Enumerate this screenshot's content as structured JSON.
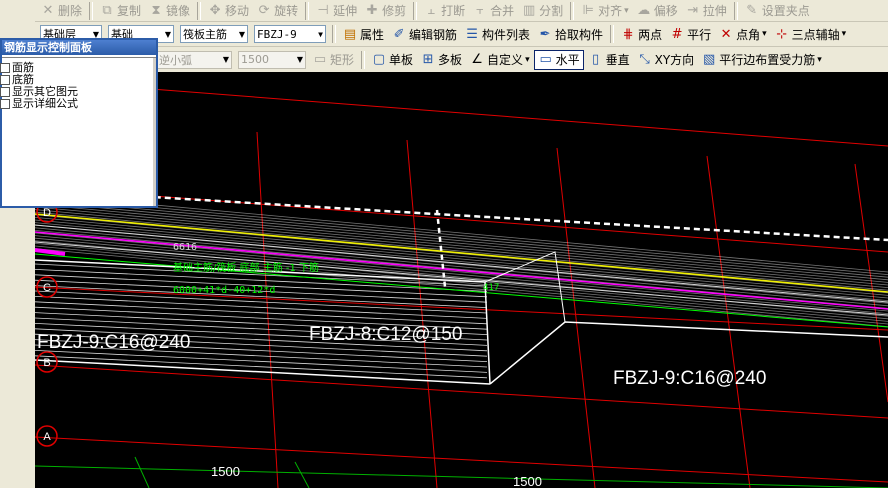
{
  "toolbar1": {
    "delete": "删除",
    "copy": "复制",
    "mirror": "镜像",
    "move": "移动",
    "rotate": "旋转",
    "extend": "延伸",
    "trim": "修剪",
    "break": "打断",
    "merge": "合并",
    "split": "分割",
    "align": "对齐",
    "offset": "偏移",
    "stretch": "拉伸",
    "set_grip": "设置夹点"
  },
  "toolbar2": {
    "floor_value": "基础层",
    "category_value": "基础",
    "type_value": "筏板主筋",
    "component_value": "FBZJ-9",
    "properties": "属性",
    "edit_rebar": "编辑钢筋",
    "component_list": "构件列表",
    "pick_component": "拾取构件",
    "two_points": "两点",
    "parallel": "平行",
    "point_angle": "点角",
    "three_point_aux": "三点辅轴"
  },
  "toolbar3": {
    "arc_value": "逆小弧",
    "radius_value": "1500",
    "rectangle": "矩形",
    "single_slab": "单板",
    "multi_slab": "多板",
    "custom": "自定义",
    "horizontal": "水平",
    "vertical": "垂直",
    "xy_direction": "XY方向",
    "parallel_edge": "平行边布置受力筋"
  },
  "panel": {
    "title": "钢筋显示控制面板",
    "items": [
      "面筋",
      "底筋",
      "显示其它图元",
      "显示详细公式"
    ]
  },
  "drawing": {
    "axis_labels": [
      "D",
      "C",
      "B",
      "A"
    ],
    "dim_6616": "6616",
    "green_note": "基础主筋/筏板 底部 主筋 -1 下筋",
    "formula": "6000+41*d-40+12*d",
    "dim_417": "417",
    "label_left": "FBZJ-9:C16@240",
    "label_middle": "FBZJ-8:C12@150",
    "label_right": "FBZJ-9:C16@240",
    "dim_1500_a": "1500",
    "dim_1500_b": "1500"
  },
  "colors": {
    "toolbar_bg": "#ece9d8",
    "canvas_bg": "#000000",
    "grid_red": "#e00000",
    "grid_green": "#00b000",
    "rebar_yellow": "#f0f000",
    "rebar_magenta": "#ff00ff",
    "rebar_green": "#00ff00",
    "panel_title": "#2c5ca8"
  }
}
